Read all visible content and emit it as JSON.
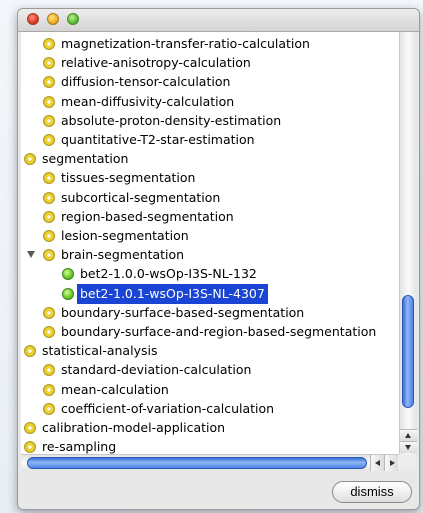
{
  "tree": {
    "rows": [
      {
        "label": "magnetization-transfer-ratio-calculation",
        "depth": 1,
        "icon": "yellow",
        "expanded": false,
        "selected": false
      },
      {
        "label": "relative-anisotropy-calculation",
        "depth": 1,
        "icon": "yellow",
        "expanded": false,
        "selected": false
      },
      {
        "label": "diffusion-tensor-calculation",
        "depth": 1,
        "icon": "yellow",
        "expanded": false,
        "selected": false
      },
      {
        "label": "mean-diffusivity-calculation",
        "depth": 1,
        "icon": "yellow",
        "expanded": false,
        "selected": false
      },
      {
        "label": "absolute-proton-density-estimation",
        "depth": 1,
        "icon": "yellow",
        "expanded": false,
        "selected": false
      },
      {
        "label": "quantitative-T2-star-estimation",
        "depth": 1,
        "icon": "yellow",
        "expanded": false,
        "selected": false
      },
      {
        "label": "segmentation",
        "depth": 0,
        "icon": "yellow",
        "expanded": false,
        "selected": false
      },
      {
        "label": "tissues-segmentation",
        "depth": 1,
        "icon": "yellow",
        "expanded": false,
        "selected": false
      },
      {
        "label": "subcortical-segmentation",
        "depth": 1,
        "icon": "yellow",
        "expanded": false,
        "selected": false
      },
      {
        "label": "region-based-segmentation",
        "depth": 1,
        "icon": "yellow",
        "expanded": false,
        "selected": false
      },
      {
        "label": "lesion-segmentation",
        "depth": 1,
        "icon": "yellow",
        "expanded": false,
        "selected": false
      },
      {
        "label": "brain-segmentation",
        "depth": 1,
        "icon": "yellow",
        "expanded": true,
        "selected": false
      },
      {
        "label": "bet2-1.0.0-wsOp-I3S-NL-132",
        "depth": 2,
        "icon": "green",
        "expanded": false,
        "selected": false
      },
      {
        "label": "bet2-1.0.1-wsOp-I3S-NL-4307",
        "depth": 2,
        "icon": "green",
        "expanded": false,
        "selected": true
      },
      {
        "label": "boundary-surface-based-segmentation",
        "depth": 1,
        "icon": "yellow",
        "expanded": false,
        "selected": false
      },
      {
        "label": "boundary-surface-and-region-based-segmentation",
        "depth": 1,
        "icon": "yellow",
        "expanded": false,
        "selected": false
      },
      {
        "label": "statistical-analysis",
        "depth": 0,
        "icon": "yellow",
        "expanded": false,
        "selected": false
      },
      {
        "label": "standard-deviation-calculation",
        "depth": 1,
        "icon": "yellow",
        "expanded": false,
        "selected": false
      },
      {
        "label": "mean-calculation",
        "depth": 1,
        "icon": "yellow",
        "expanded": false,
        "selected": false
      },
      {
        "label": "coefficient-of-variation-calculation",
        "depth": 1,
        "icon": "yellow",
        "expanded": false,
        "selected": false
      },
      {
        "label": "calibration-model-application",
        "depth": 0,
        "icon": "yellow",
        "expanded": false,
        "selected": false
      },
      {
        "label": "re-sampling",
        "depth": 0,
        "icon": "yellow",
        "expanded": false,
        "selected": false
      }
    ]
  },
  "buttons": {
    "dismiss_label": "dismiss"
  },
  "icons": {
    "collapsed_node": "yellow-node-icon",
    "leaf_service": "green-service-icon",
    "expander": "disclosure-triangle-icon"
  },
  "colors": {
    "selection_bg": "#1a44d4",
    "selection_text": "#ffffff",
    "scroll_thumb": "#4d82e4"
  }
}
